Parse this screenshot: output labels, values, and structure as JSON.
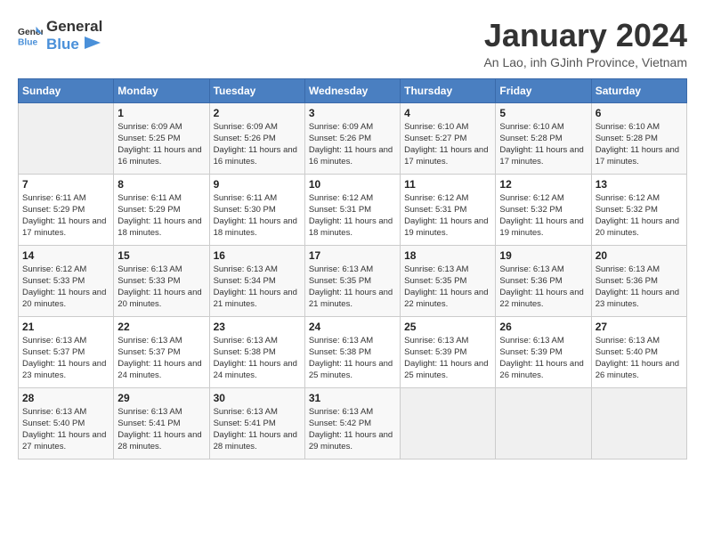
{
  "header": {
    "logo_general": "General",
    "logo_blue": "Blue",
    "title": "January 2024",
    "subtitle": "An Lao, inh GJinh Province, Vietnam"
  },
  "calendar": {
    "days_of_week": [
      "Sunday",
      "Monday",
      "Tuesday",
      "Wednesday",
      "Thursday",
      "Friday",
      "Saturday"
    ],
    "weeks": [
      [
        {
          "day": "",
          "empty": true
        },
        {
          "day": "1",
          "sunrise": "6:09 AM",
          "sunset": "5:25 PM",
          "daylight": "11 hours and 16 minutes."
        },
        {
          "day": "2",
          "sunrise": "6:09 AM",
          "sunset": "5:26 PM",
          "daylight": "11 hours and 16 minutes."
        },
        {
          "day": "3",
          "sunrise": "6:09 AM",
          "sunset": "5:26 PM",
          "daylight": "11 hours and 16 minutes."
        },
        {
          "day": "4",
          "sunrise": "6:10 AM",
          "sunset": "5:27 PM",
          "daylight": "11 hours and 17 minutes."
        },
        {
          "day": "5",
          "sunrise": "6:10 AM",
          "sunset": "5:28 PM",
          "daylight": "11 hours and 17 minutes."
        },
        {
          "day": "6",
          "sunrise": "6:10 AM",
          "sunset": "5:28 PM",
          "daylight": "11 hours and 17 minutes."
        }
      ],
      [
        {
          "day": "7",
          "sunrise": "6:11 AM",
          "sunset": "5:29 PM",
          "daylight": "11 hours and 17 minutes."
        },
        {
          "day": "8",
          "sunrise": "6:11 AM",
          "sunset": "5:29 PM",
          "daylight": "11 hours and 18 minutes."
        },
        {
          "day": "9",
          "sunrise": "6:11 AM",
          "sunset": "5:30 PM",
          "daylight": "11 hours and 18 minutes."
        },
        {
          "day": "10",
          "sunrise": "6:12 AM",
          "sunset": "5:31 PM",
          "daylight": "11 hours and 18 minutes."
        },
        {
          "day": "11",
          "sunrise": "6:12 AM",
          "sunset": "5:31 PM",
          "daylight": "11 hours and 19 minutes."
        },
        {
          "day": "12",
          "sunrise": "6:12 AM",
          "sunset": "5:32 PM",
          "daylight": "11 hours and 19 minutes."
        },
        {
          "day": "13",
          "sunrise": "6:12 AM",
          "sunset": "5:32 PM",
          "daylight": "11 hours and 20 minutes."
        }
      ],
      [
        {
          "day": "14",
          "sunrise": "6:12 AM",
          "sunset": "5:33 PM",
          "daylight": "11 hours and 20 minutes."
        },
        {
          "day": "15",
          "sunrise": "6:13 AM",
          "sunset": "5:33 PM",
          "daylight": "11 hours and 20 minutes."
        },
        {
          "day": "16",
          "sunrise": "6:13 AM",
          "sunset": "5:34 PM",
          "daylight": "11 hours and 21 minutes."
        },
        {
          "day": "17",
          "sunrise": "6:13 AM",
          "sunset": "5:35 PM",
          "daylight": "11 hours and 21 minutes."
        },
        {
          "day": "18",
          "sunrise": "6:13 AM",
          "sunset": "5:35 PM",
          "daylight": "11 hours and 22 minutes."
        },
        {
          "day": "19",
          "sunrise": "6:13 AM",
          "sunset": "5:36 PM",
          "daylight": "11 hours and 22 minutes."
        },
        {
          "day": "20",
          "sunrise": "6:13 AM",
          "sunset": "5:36 PM",
          "daylight": "11 hours and 23 minutes."
        }
      ],
      [
        {
          "day": "21",
          "sunrise": "6:13 AM",
          "sunset": "5:37 PM",
          "daylight": "11 hours and 23 minutes."
        },
        {
          "day": "22",
          "sunrise": "6:13 AM",
          "sunset": "5:37 PM",
          "daylight": "11 hours and 24 minutes."
        },
        {
          "day": "23",
          "sunrise": "6:13 AM",
          "sunset": "5:38 PM",
          "daylight": "11 hours and 24 minutes."
        },
        {
          "day": "24",
          "sunrise": "6:13 AM",
          "sunset": "5:38 PM",
          "daylight": "11 hours and 25 minutes."
        },
        {
          "day": "25",
          "sunrise": "6:13 AM",
          "sunset": "5:39 PM",
          "daylight": "11 hours and 25 minutes."
        },
        {
          "day": "26",
          "sunrise": "6:13 AM",
          "sunset": "5:39 PM",
          "daylight": "11 hours and 26 minutes."
        },
        {
          "day": "27",
          "sunrise": "6:13 AM",
          "sunset": "5:40 PM",
          "daylight": "11 hours and 26 minutes."
        }
      ],
      [
        {
          "day": "28",
          "sunrise": "6:13 AM",
          "sunset": "5:40 PM",
          "daylight": "11 hours and 27 minutes."
        },
        {
          "day": "29",
          "sunrise": "6:13 AM",
          "sunset": "5:41 PM",
          "daylight": "11 hours and 28 minutes."
        },
        {
          "day": "30",
          "sunrise": "6:13 AM",
          "sunset": "5:41 PM",
          "daylight": "11 hours and 28 minutes."
        },
        {
          "day": "31",
          "sunrise": "6:13 AM",
          "sunset": "5:42 PM",
          "daylight": "11 hours and 29 minutes."
        },
        {
          "day": "",
          "empty": true
        },
        {
          "day": "",
          "empty": true
        },
        {
          "day": "",
          "empty": true
        }
      ]
    ]
  },
  "labels": {
    "sunrise_prefix": "Sunrise: ",
    "sunset_prefix": "Sunset: ",
    "daylight_prefix": "Daylight: "
  }
}
